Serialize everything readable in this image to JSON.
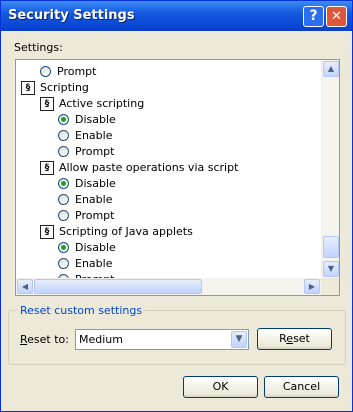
{
  "window": {
    "title": "Security Settings"
  },
  "title_buttons": {
    "help": "?",
    "close": "✕"
  },
  "settings": {
    "label": "Settings:",
    "items": [
      {
        "kind": "radio",
        "label": "Prompt",
        "selected": false,
        "indent": 1
      },
      {
        "kind": "folder",
        "label": "Scripting",
        "indent": 0
      },
      {
        "kind": "folder",
        "label": "Active scripting",
        "indent": 1
      },
      {
        "kind": "radio",
        "label": "Disable",
        "selected": true,
        "indent": 2
      },
      {
        "kind": "radio",
        "label": "Enable",
        "selected": false,
        "indent": 2
      },
      {
        "kind": "radio",
        "label": "Prompt",
        "selected": false,
        "indent": 2
      },
      {
        "kind": "folder",
        "label": "Allow paste operations via script",
        "indent": 1
      },
      {
        "kind": "radio",
        "label": "Disable",
        "selected": true,
        "indent": 2
      },
      {
        "kind": "radio",
        "label": "Enable",
        "selected": false,
        "indent": 2
      },
      {
        "kind": "radio",
        "label": "Prompt",
        "selected": false,
        "indent": 2
      },
      {
        "kind": "folder",
        "label": "Scripting of Java applets",
        "indent": 1
      },
      {
        "kind": "radio",
        "label": "Disable",
        "selected": true,
        "indent": 2
      },
      {
        "kind": "radio",
        "label": "Enable",
        "selected": false,
        "indent": 2
      },
      {
        "kind": "radio",
        "label": "Prompt",
        "selected": false,
        "indent": 2
      }
    ]
  },
  "reset": {
    "group_label": "Reset custom settings",
    "reset_to_label": "Reset to:",
    "selected": "Medium",
    "button": "Reset"
  },
  "buttons": {
    "ok": "OK",
    "cancel": "Cancel"
  },
  "colors": {
    "title_bar": "#0a46d4",
    "group_label": "#0046d5",
    "radio_dot": "#21a121",
    "dialog_bg": "#ece9d8"
  },
  "icons": {
    "folder": "script-settings-icon",
    "scroll_up": "arrow-up-icon",
    "scroll_down": "arrow-down-icon",
    "scroll_left": "arrow-left-icon",
    "scroll_right": "arrow-right-icon",
    "dropdown": "chevron-down-icon"
  }
}
